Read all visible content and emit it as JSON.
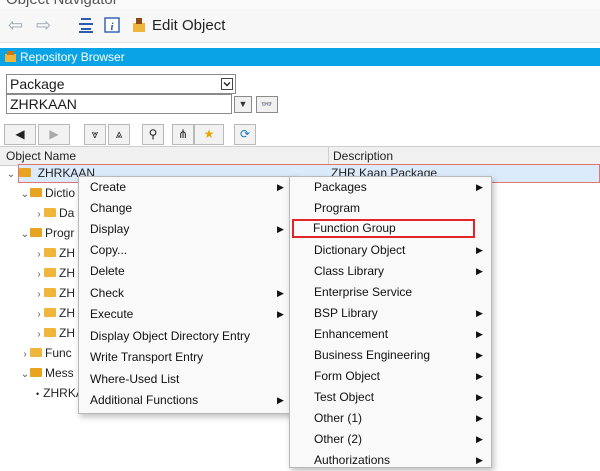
{
  "window": {
    "title": "Object Navigator"
  },
  "toolbar": {
    "edit_object_label": "Edit Object"
  },
  "repository_browser": {
    "title": "Repository Browser",
    "object_list_type": "Package",
    "object_name": "ZHRKAAN"
  },
  "columns": {
    "object_name": "Object Name",
    "description": "Description"
  },
  "tree": [
    {
      "label": "ZHRKAAN",
      "description": "ZHR Kaan Package"
    },
    {
      "label": "Dictio"
    },
    {
      "label": "Da"
    },
    {
      "label": "Progr"
    },
    {
      "label": "ZH"
    },
    {
      "label": "ZH"
    },
    {
      "label": "ZH"
    },
    {
      "label": "ZH"
    },
    {
      "label": "ZH"
    },
    {
      "label": "Func"
    },
    {
      "label": "Mess"
    },
    {
      "label": "ZHRKA"
    }
  ],
  "context_menu": [
    {
      "label": "Create",
      "submenu": true
    },
    {
      "label": "Change",
      "submenu": false
    },
    {
      "label": "Display",
      "submenu": true
    },
    {
      "label": "Copy...",
      "submenu": false
    },
    {
      "label": "Delete",
      "submenu": false
    },
    {
      "label": "Check",
      "submenu": true
    },
    {
      "label": "Execute",
      "submenu": true
    },
    {
      "label": "Display Object Directory Entry",
      "submenu": false
    },
    {
      "label": "Write Transport Entry",
      "submenu": false
    },
    {
      "label": "Where-Used List",
      "submenu": false
    },
    {
      "label": "Additional Functions",
      "submenu": true
    }
  ],
  "create_submenu": [
    {
      "label": "Packages",
      "submenu": true
    },
    {
      "label": "Program",
      "submenu": false
    },
    {
      "label": "Function Group",
      "submenu": false
    },
    {
      "label": "Dictionary Object",
      "submenu": true
    },
    {
      "label": "Class Library",
      "submenu": true
    },
    {
      "label": "Enterprise Service",
      "submenu": false
    },
    {
      "label": "BSP Library",
      "submenu": true
    },
    {
      "label": "Enhancement",
      "submenu": true
    },
    {
      "label": "Business Engineering",
      "submenu": true
    },
    {
      "label": "Form Object",
      "submenu": true
    },
    {
      "label": "Test Object",
      "submenu": true
    },
    {
      "label": "Other (1)",
      "submenu": true
    },
    {
      "label": "Other (2)",
      "submenu": true
    },
    {
      "label": "Authorizations",
      "submenu": true
    }
  ],
  "colors": {
    "accent": "#0aa3e6",
    "highlight_border": "#e0262b",
    "folder": "#f0b53d"
  },
  "icons": [
    "back-arrow-icon",
    "forward-arrow-icon",
    "tree-structure-icon",
    "info-icon",
    "edit-object-icon",
    "repository-icon",
    "dropdown-icon",
    "glasses-icon",
    "expand-all-icon",
    "collapse-all-icon",
    "binoculars-icon",
    "hierarchy-icon",
    "favorite-star-icon",
    "refresh-icon",
    "folder-icon"
  ]
}
